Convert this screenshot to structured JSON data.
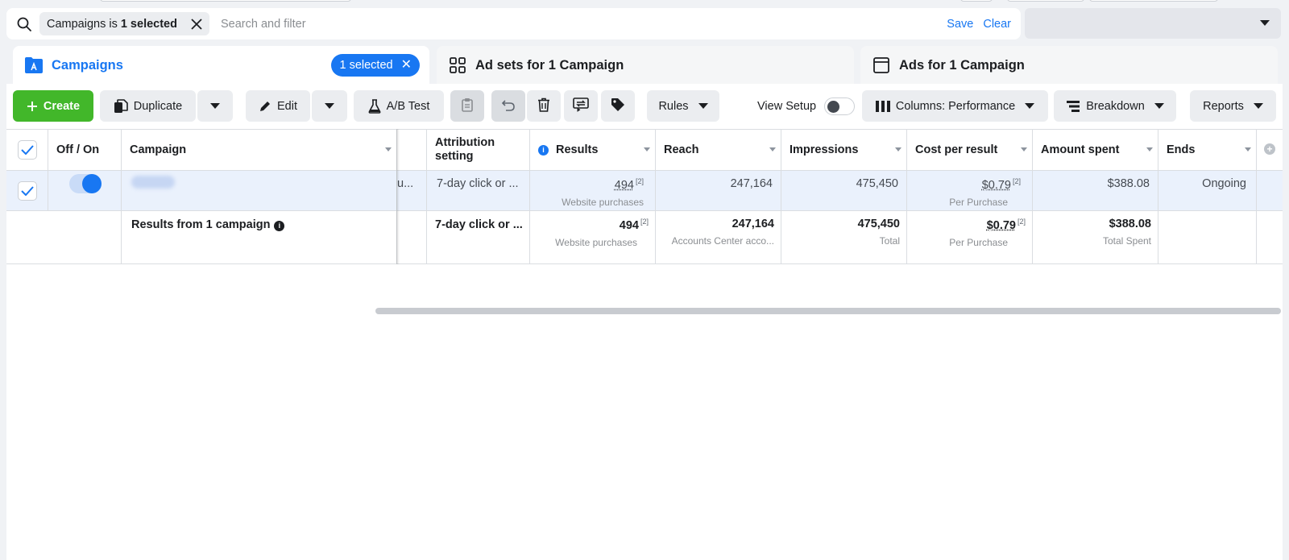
{
  "filter_bar": {
    "chip_prefix": "Campaigns is",
    "chip_value": "1 selected",
    "search_placeholder": "Search and filter",
    "save_label": "Save",
    "clear_label": "Clear"
  },
  "tabs": {
    "campaigns": {
      "label": "Campaigns",
      "pill": "1 selected"
    },
    "ad_sets": {
      "label": "Ad sets for 1 Campaign"
    },
    "ads": {
      "label": "Ads for 1 Campaign"
    }
  },
  "toolbar": {
    "create": "Create",
    "duplicate": "Duplicate",
    "edit": "Edit",
    "ab_test": "A/B Test",
    "rules": "Rules",
    "view_setup": "View Setup",
    "columns": "Columns: Performance",
    "breakdown": "Breakdown",
    "reports": "Reports"
  },
  "table": {
    "headers": {
      "off_on": "Off / On",
      "campaign": "Campaign",
      "attribution": "Attribution setting",
      "results": "Results",
      "reach": "Reach",
      "impressions": "Impressions",
      "cost_per_result": "Cost per result",
      "amount_spent": "Amount spent",
      "ends": "Ends"
    },
    "row": {
      "truncated_prefix": "u...",
      "attribution": "7-day click or ...",
      "results": "494",
      "results_note": "[2]",
      "results_sub": "Website purchases",
      "reach": "247,164",
      "impressions": "475,450",
      "cost_per_result": "$0.79",
      "cost_note": "[2]",
      "cost_sub": "Per Purchase",
      "amount_spent": "$388.08",
      "ends": "Ongoing"
    },
    "totals": {
      "label": "Results from 1 campaign",
      "attribution": "7-day click or ...",
      "results": "494",
      "results_note": "[2]",
      "results_sub": "Website purchases",
      "reach": "247,164",
      "reach_sub": "Accounts Center acco...",
      "impressions": "475,450",
      "impressions_sub": "Total",
      "cost_per_result": "$0.79",
      "cost_note": "[2]",
      "cost_sub": "Per Purchase",
      "amount_spent": "$388.08",
      "amount_sub": "Total Spent"
    }
  },
  "colors": {
    "accent": "#1877f2",
    "create": "#42b72a",
    "selected_row": "#eaf1fc"
  }
}
